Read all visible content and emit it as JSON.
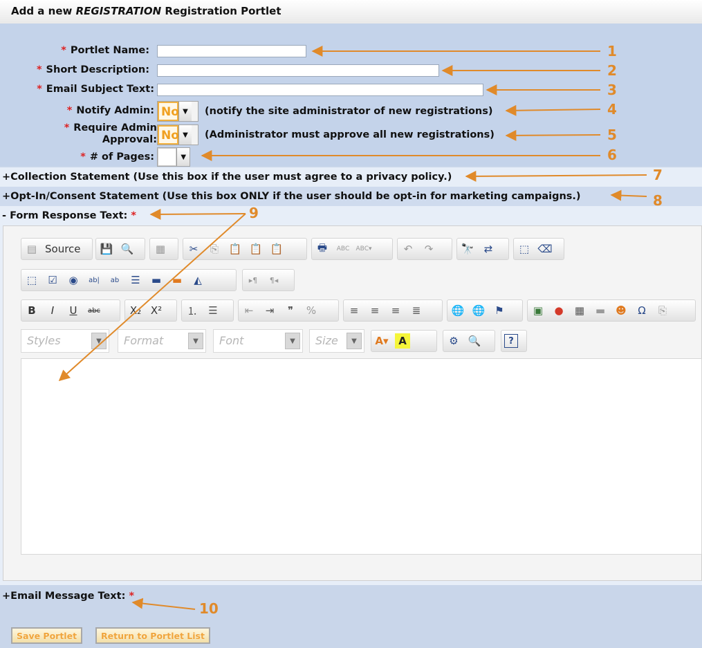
{
  "title": {
    "prefix": "Add a new ",
    "emph": "REGISTRATION",
    "suffix": " Registration Portlet"
  },
  "form": {
    "required_mark": "*",
    "portlet_name_label": "Portlet Name:",
    "short_desc_label": "Short Description:",
    "email_subject_label": "Email Subject Text:",
    "notify_admin_label": "Notify Admin:",
    "notify_admin_value": "No",
    "notify_admin_hint": "(notify the site administrator of new registrations)",
    "require_admin_label_1": "Require Admin",
    "require_admin_label_2": "Approval:",
    "require_admin_value": "No",
    "require_admin_hint": "(Administrator must approve all new registrations)",
    "pages_label": "# of Pages:",
    "pages_value": ""
  },
  "sections": {
    "collection": "+Collection Statement (Use this box if the user must agree to a privacy policy.)",
    "optin": "+Opt-In/Consent Statement (Use this box ONLY if the user should be opt-in for marketing campaigns.)",
    "form_response": "- Form Response Text:",
    "email_message": "+Email Message Text:"
  },
  "editor": {
    "source_label": "Source",
    "styles": "Styles",
    "format": "Format",
    "font": "Font",
    "size": "Size"
  },
  "buttons": {
    "save": "Save Portlet",
    "return": "Return to Portlet List"
  },
  "annotations": [
    "1",
    "2",
    "3",
    "4",
    "5",
    "6",
    "7",
    "8",
    "9",
    "10"
  ],
  "colors": {
    "annotation": "#e08a2a",
    "required": "#dd2222",
    "panel": "#c4d3ea"
  }
}
